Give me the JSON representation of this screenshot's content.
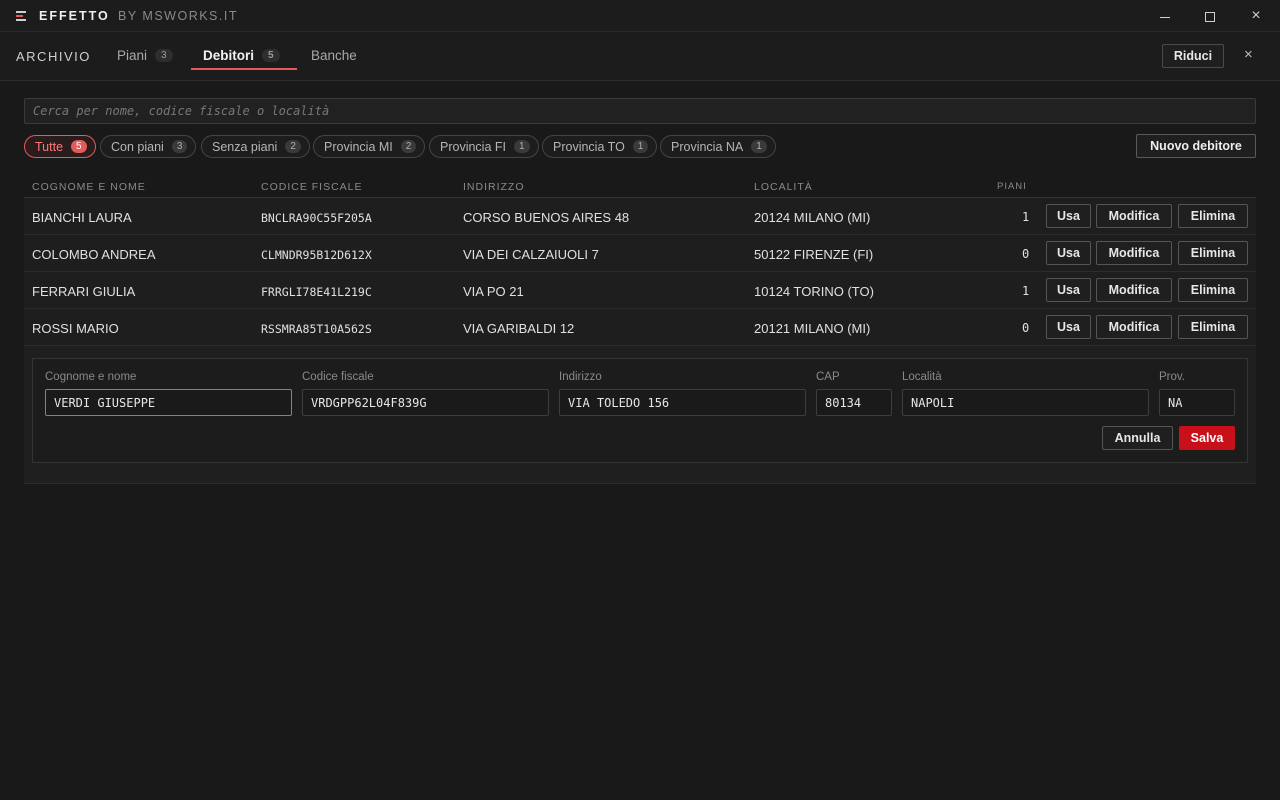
{
  "window": {
    "app_name": "EFFETTO",
    "app_subtitle": "BY MSWORKS.IT",
    "minimize": "",
    "close": "×"
  },
  "nav": {
    "section": "ARCHIVIO",
    "tabs": [
      {
        "label": "Piani",
        "count": "3"
      },
      {
        "label": "Debitori",
        "count": "5"
      },
      {
        "label": "Banche"
      }
    ],
    "riduci_label": "Riduci",
    "close_label": "×"
  },
  "search": {
    "placeholder": "Cerca per nome, codice fiscale o località"
  },
  "filters": [
    {
      "label": "Tutte",
      "count": "5"
    },
    {
      "label": "Con piani",
      "count": "3"
    },
    {
      "label": "Senza piani",
      "count": "2"
    },
    {
      "label": "Provincia MI",
      "count": "2"
    },
    {
      "label": "Provincia FI",
      "count": "1"
    },
    {
      "label": "Provincia TO",
      "count": "1"
    },
    {
      "label": "Provincia NA",
      "count": "1"
    }
  ],
  "new_debtor_label": "Nuovo debitore",
  "table": {
    "headers": {
      "name": "COGNOME E NOME",
      "cf": "CODICE FISCALE",
      "address": "INDIRIZZO",
      "city": "LOCALITÀ",
      "plans": "PIANI"
    },
    "actions": {
      "use": "Usa",
      "edit": "Modifica",
      "delete": "Elimina"
    },
    "rows": [
      {
        "name": "BIANCHI LAURA",
        "cf": "BNCLRA90C55F205A",
        "address": "CORSO BUENOS AIRES 48",
        "city": "20124 MILANO (MI)",
        "plans": "1"
      },
      {
        "name": "COLOMBO ANDREA",
        "cf": "CLMNDR95B12D612X",
        "address": "VIA DEI CALZAIUOLI 7",
        "city": "50122 FIRENZE (FI)",
        "plans": "0"
      },
      {
        "name": "FERRARI GIULIA",
        "cf": "FRRGLI78E41L219C",
        "address": "VIA PO 21",
        "city": "10124 TORINO (TO)",
        "plans": "1"
      },
      {
        "name": "ROSSI MARIO",
        "cf": "RSSMRA85T10A562S",
        "address": "VIA GARIBALDI 12",
        "city": "20121 MILANO (MI)",
        "plans": "0"
      }
    ]
  },
  "form": {
    "labels": {
      "name": "Cognome e nome",
      "cf": "Codice fiscale",
      "address": "Indirizzo",
      "cap": "CAP",
      "city": "Località",
      "prov": "Prov."
    },
    "values": {
      "name": "VERDI GIUSEPPE",
      "cf": "VRDGPP62L04F839G",
      "address": "VIA TOLEDO 156",
      "cap": "80134",
      "city": "NAPOLI",
      "prov": "NA"
    },
    "cancel_label": "Annulla",
    "save_label": "Salva"
  },
  "colors": {
    "accent": "#e25a5a",
    "save": "#c8101a",
    "background": "#191919"
  }
}
